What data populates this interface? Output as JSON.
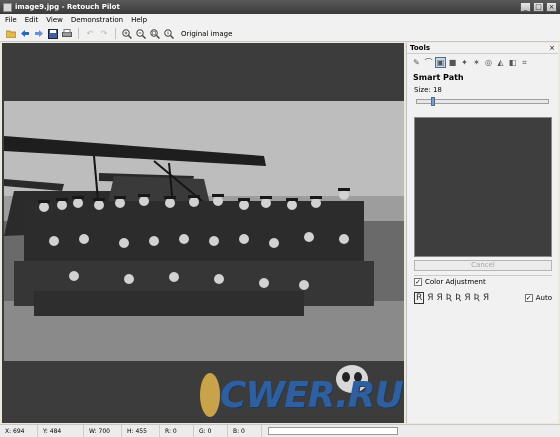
{
  "window": {
    "title": "image9.jpg - Retouch Pilot",
    "controls": {
      "minimize": "_",
      "maximize": "□",
      "close": "×"
    }
  },
  "menu": [
    "File",
    "Edit",
    "View",
    "Demonstration",
    "Help"
  ],
  "toolbar": {
    "icons": [
      "open-folder-icon",
      "back-arrow-icon",
      "forward-arrow-icon",
      "save-icon",
      "print-icon",
      "undo-icon",
      "redo-icon",
      "zoom-in-icon",
      "zoom-out-icon",
      "zoom-fit-icon",
      "zoom-actual-icon"
    ],
    "original_image_label": "Original image"
  },
  "tools_panel": {
    "title": "Tools",
    "close": "×",
    "tool_name": "Smart Path",
    "size_label": "Size: 18",
    "size_value": 18,
    "cancel_label": "Cancel",
    "color_adjustment_label": "Color Adjustment",
    "color_adjustment_checked": true,
    "presets": [
      "R",
      "Я",
      "Я",
      "Ʀ",
      "Ʀ",
      "Я",
      "Ʀ",
      "Я"
    ],
    "auto_label": "Auto",
    "auto_checked": true
  },
  "watermark": {
    "text": "CWER.RU"
  },
  "status": {
    "x": "X: 694",
    "y": "Y: 484",
    "w": "W: 700",
    "h": "H: 455",
    "r": "R: 0",
    "g": "G: 0",
    "b": "B: 0"
  }
}
